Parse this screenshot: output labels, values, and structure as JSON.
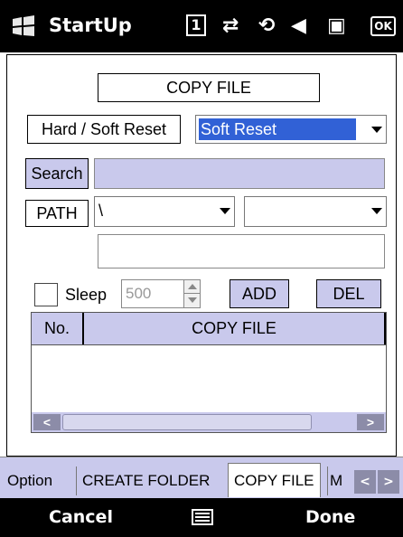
{
  "statusbar": {
    "app_title": "StartUp",
    "icons": [
      "windows-logo-icon",
      "sim-card-icon",
      "connectivity-icon",
      "sync-icon",
      "speaker-icon",
      "battery-icon"
    ],
    "sim_glyph": "1",
    "ok_label": "OK"
  },
  "form": {
    "title": "COPY FILE",
    "reset_label": "Hard / Soft Reset",
    "reset_value": "Soft Reset",
    "search_label": "Search",
    "search_value": "",
    "path_label": "PATH",
    "path_value": "\\",
    "path_value2": "",
    "extra_value": "",
    "sleep_label": "Sleep",
    "sleep_value": "500",
    "add_label": "ADD",
    "del_label": "DEL"
  },
  "list": {
    "columns": [
      "No.",
      "COPY FILE"
    ],
    "rows": []
  },
  "tabs": [
    {
      "label": "Option"
    },
    {
      "label": "CREATE FOLDER"
    },
    {
      "label": "COPY FILE"
    },
    {
      "label": "M"
    }
  ],
  "softkeys": {
    "left": "Cancel",
    "right": "Done"
  },
  "colors": {
    "accent": "#c9c9ec",
    "selection": "#3161d6"
  }
}
